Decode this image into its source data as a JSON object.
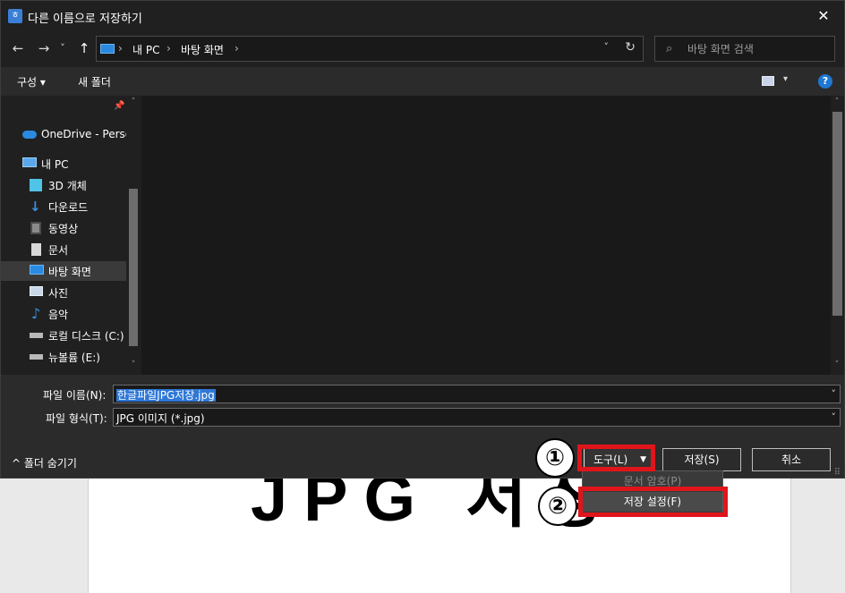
{
  "background": {
    "document_text": "JPG 저장"
  },
  "dialog": {
    "title": "다른 이름으로 저장하기",
    "title_icon_glyph": "ㅎ",
    "close_glyph": "✕"
  },
  "nav": {
    "back_glyph": "←",
    "forward_glyph": "→",
    "recent_glyph": "˅",
    "up_glyph": "↑",
    "breadcrumbs": [
      "내 PC",
      "바탕 화면"
    ],
    "crumb_separator": "›",
    "dropdown_glyph": "˅",
    "refresh_glyph": "↻"
  },
  "search": {
    "icon_glyph": "⌕",
    "placeholder": "바탕 화면 검색"
  },
  "toolbar": {
    "organize_label": "구성 ▾",
    "new_folder_label": "새 폴더",
    "view_arrow_glyph": "▾",
    "help_glyph": "?"
  },
  "sidebar": {
    "pin_glyph": "📌",
    "scroll_up_glyph": "˄",
    "scroll_down_glyph": "˅",
    "items": [
      {
        "label": "OneDrive - Persor",
        "icon": "cloud-icon",
        "color": "#2a8ae0"
      },
      {
        "label": "내 PC",
        "icon": "computer-icon",
        "color": "#5aa8ec"
      },
      {
        "label": "3D 개체",
        "icon": "cube-icon",
        "color": "#4fc3e8"
      },
      {
        "label": "다운로드",
        "icon": "download-arrow-icon",
        "color": "#3a8fe0"
      },
      {
        "label": "동영상",
        "icon": "film-icon",
        "color": "#8a8a8a"
      },
      {
        "label": "문서",
        "icon": "document-icon",
        "color": "#d8d8d8"
      },
      {
        "label": "바탕 화면",
        "icon": "desktop-icon",
        "color": "#2a8ae0"
      },
      {
        "label": "사진",
        "icon": "picture-icon",
        "color": "#c8d8e8"
      },
      {
        "label": "음악",
        "icon": "music-note-icon",
        "color": "#3a8fe0"
      },
      {
        "label": "로컬 디스크 (C:)",
        "icon": "drive-c-icon",
        "color": "#b8b8b8"
      },
      {
        "label": "뉴볼륨 (E:)",
        "icon": "drive-e-icon",
        "color": "#b8b8b8"
      }
    ]
  },
  "form": {
    "filename_label": "파일 이름(N):",
    "filename_value": "한글파일JPG저장.jpg",
    "filetype_label": "파일 형식(T):",
    "filetype_value": "JPG 이미지 (*.jpg)",
    "dropdown_glyph": "˅",
    "hide_folders_label": "^ 폴더 숨기기",
    "tools_label": "도구(L)",
    "tools_arrow_glyph": "▼",
    "save_label": "저장(S)",
    "cancel_label": "취소",
    "resize_glyph": "⠿"
  },
  "tools_menu": {
    "items": [
      "문서 암호(P)",
      "저장 설정(F)"
    ]
  },
  "annotations": {
    "marker_1": "①",
    "marker_2": "②",
    "highlight_color": "#e0151b"
  }
}
